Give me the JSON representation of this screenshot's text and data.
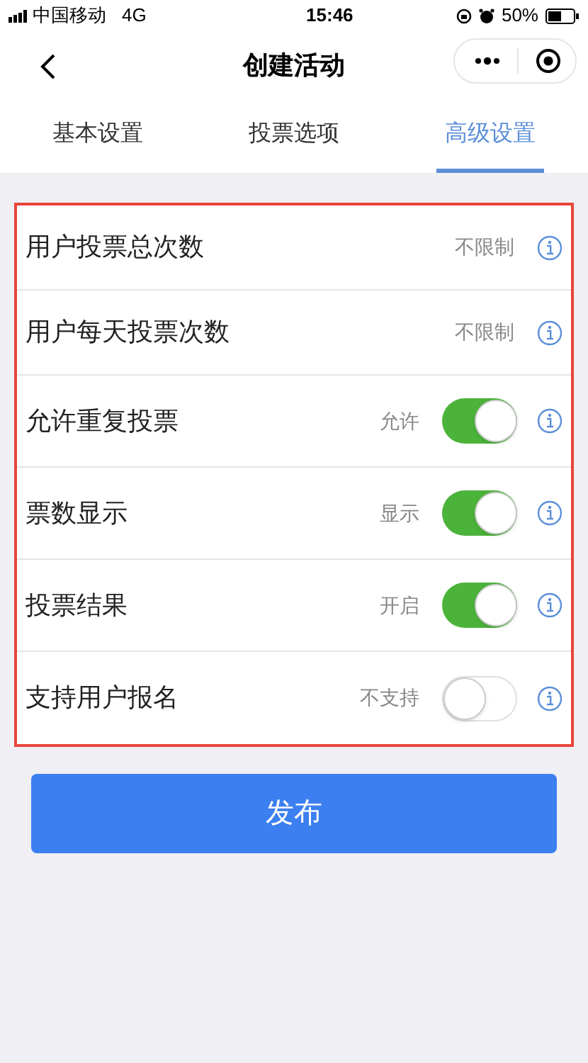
{
  "status_bar": {
    "carrier": "中国移动",
    "network": "4G",
    "time": "15:46",
    "battery": "50%"
  },
  "nav": {
    "title": "创建活动"
  },
  "tabs": [
    {
      "label": "基本设置",
      "selected": false
    },
    {
      "label": "投票选项",
      "selected": false
    },
    {
      "label": "高级设置",
      "selected": true
    }
  ],
  "settings": [
    {
      "kind": "value",
      "label": "用户投票总次数",
      "value": "不限制"
    },
    {
      "kind": "value",
      "label": "用户每天投票次数",
      "value": "不限制"
    },
    {
      "kind": "toggle",
      "label": "允许重复投票",
      "value": "允许",
      "on": true
    },
    {
      "kind": "toggle",
      "label": "票数显示",
      "value": "显示",
      "on": true
    },
    {
      "kind": "toggle",
      "label": "投票结果",
      "value": "开启",
      "on": true
    },
    {
      "kind": "toggle",
      "label": "支持用户报名",
      "value": "不支持",
      "on": false
    }
  ],
  "publish_button": "发布"
}
